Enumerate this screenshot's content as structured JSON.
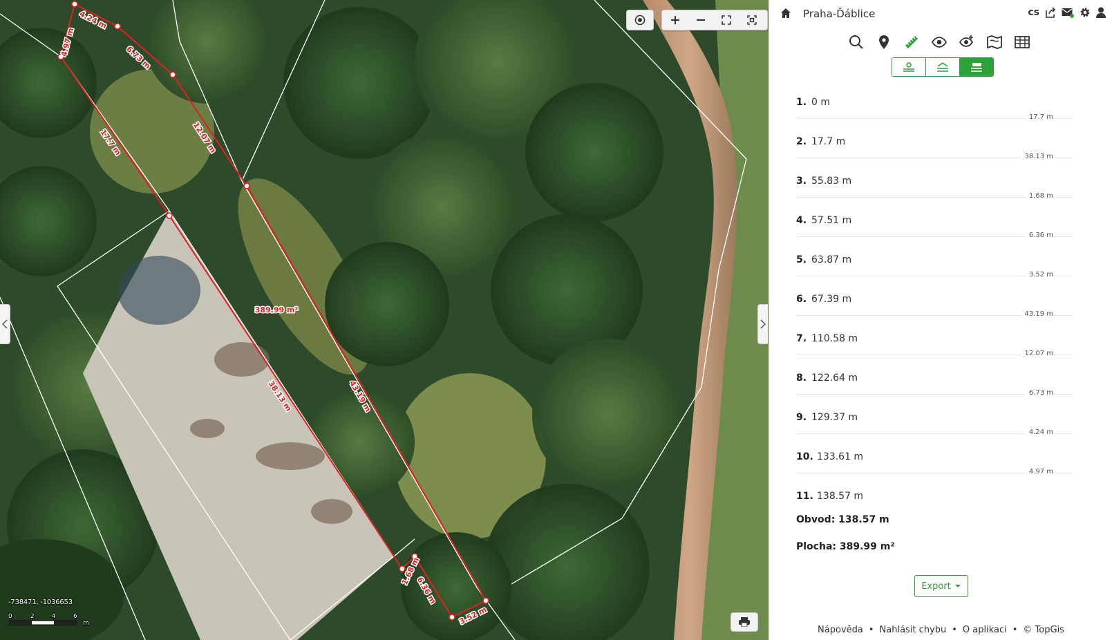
{
  "header": {
    "title": "Praha-Ďáblice",
    "lang": "cs"
  },
  "map": {
    "coords": "-738471, -1036653",
    "scale_ticks": [
      "0",
      "2",
      "4",
      "6"
    ],
    "scale_unit": "m",
    "area_label": "389.99 m²",
    "segment_labels": [
      "4.97 m",
      "4.24 m",
      "6.73 m",
      "12.07 m",
      "17.7 m",
      "43.19 m",
      "38.13 m",
      "1.68 m",
      "6.36 m",
      "3.52 m"
    ]
  },
  "measure": {
    "points": [
      {
        "idx": "1.",
        "dist": "0 m",
        "seg": "17.7 m"
      },
      {
        "idx": "2.",
        "dist": "17.7 m",
        "seg": "38.13 m"
      },
      {
        "idx": "3.",
        "dist": "55.83 m",
        "seg": "1.68 m"
      },
      {
        "idx": "4.",
        "dist": "57.51 m",
        "seg": "6.36 m"
      },
      {
        "idx": "5.",
        "dist": "63.87 m",
        "seg": "3.52 m"
      },
      {
        "idx": "6.",
        "dist": "67.39 m",
        "seg": "43.19 m"
      },
      {
        "idx": "7.",
        "dist": "110.58 m",
        "seg": "12.07 m"
      },
      {
        "idx": "8.",
        "dist": "122.64 m",
        "seg": "6.73 m"
      },
      {
        "idx": "9.",
        "dist": "129.37 m",
        "seg": "4.24 m"
      },
      {
        "idx": "10.",
        "dist": "133.61 m",
        "seg": "4.97 m"
      },
      {
        "idx": "11.",
        "dist": "138.57 m",
        "seg": ""
      }
    ],
    "perimeter": "Obvod: 138.57 m",
    "area": "Plocha: 389.99 m²",
    "export_label": "Export"
  },
  "footer": {
    "help": "Nápověda",
    "report": "Nahlásit chybu",
    "about": "O aplikaci",
    "copyright": "© TopGis"
  },
  "colors": {
    "accent": "#2ea23a",
    "measure_line": "#e02020"
  }
}
